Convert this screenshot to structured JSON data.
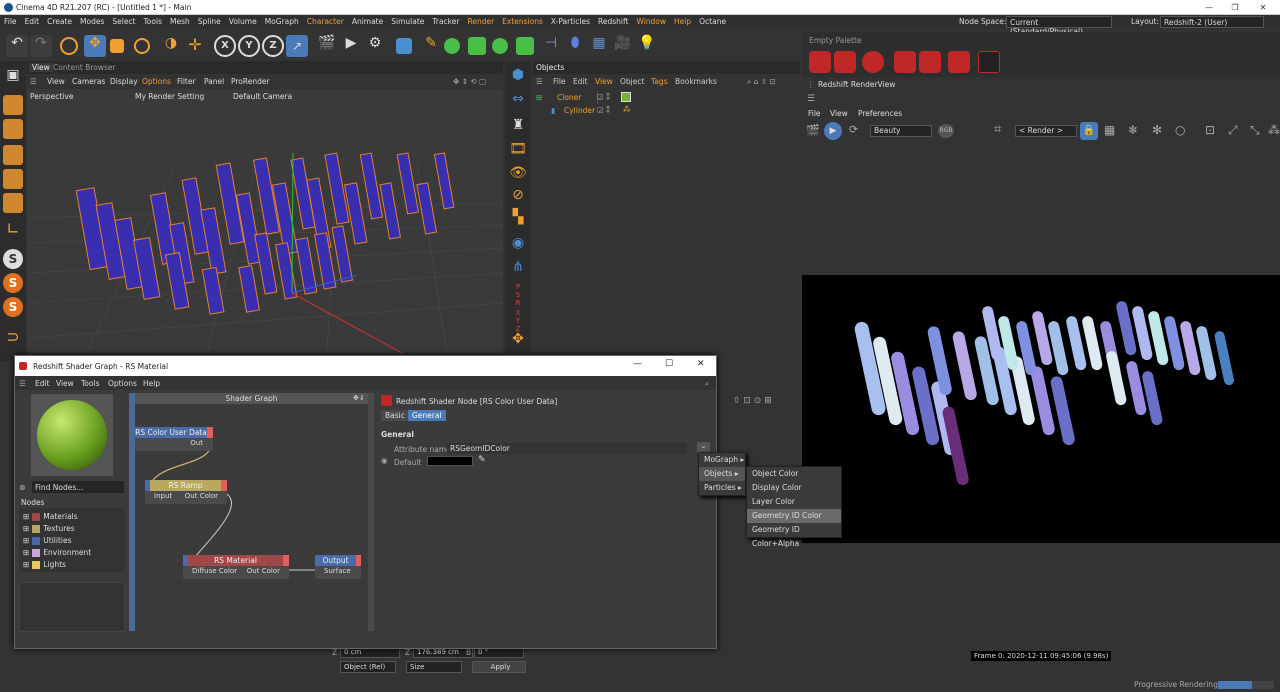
{
  "window": {
    "title": "Cinema 4D R21.207 (RC) - [Untitled 1 *] - Main"
  },
  "menubar": {
    "items": [
      "File",
      "Edit",
      "Create",
      "Modes",
      "Select",
      "Tools",
      "Mesh",
      "Spline",
      "Volume",
      "MoGraph",
      "Character",
      "Animate",
      "Simulate",
      "Tracker",
      "Render",
      "Extensions",
      "X-Particles",
      "Redshift",
      "Window",
      "Help",
      "Octane"
    ],
    "node_space_label": "Node Space:",
    "node_space_value": "Current (Standard/Physical)",
    "layout_label": "Layout:",
    "layout_value": "Redshift-2 (User)"
  },
  "viewport": {
    "tabs": [
      "View",
      "Content Browser"
    ],
    "menu": [
      "View",
      "Cameras",
      "Display",
      "Options",
      "Filter",
      "Panel",
      "ProRender"
    ],
    "camera": "Perspective",
    "render_setting": "My Render Setting",
    "default_camera": "Default Camera"
  },
  "objects": {
    "tab": "Objects",
    "menu": [
      "File",
      "Edit",
      "View",
      "Object",
      "Tags",
      "Bookmarks"
    ],
    "rows": [
      {
        "name": "Cloner"
      },
      {
        "name": "Cylinder"
      }
    ]
  },
  "palette": {
    "label": "Empty Palette"
  },
  "renderview": {
    "title": "Redshift RenderView",
    "menu": [
      "File",
      "View",
      "Preferences"
    ],
    "aov": "Beauty",
    "camera": "< Render >",
    "frame_info": "Frame  0:  2020-12-11  09:45:06  (9.98s)",
    "status": "Progressive Rendering...",
    "progress": 0.6
  },
  "shader_graph": {
    "title": "Redshift Shader Graph - RS Material",
    "menu": [
      "Edit",
      "View",
      "Tools",
      "Options",
      "Help"
    ],
    "canvas_title": "Shader Graph",
    "find_placeholder": "Find Nodes...",
    "nodes_label": "Nodes",
    "tree": [
      {
        "label": "Materials",
        "color": "#a04848"
      },
      {
        "label": "Textures",
        "color": "#b8a860"
      },
      {
        "label": "Utilities",
        "color": "#4a64a8"
      },
      {
        "label": "Environment",
        "color": "#c8a8d8"
      },
      {
        "label": "Lights",
        "color": "#e8c860"
      }
    ],
    "node_color_user_data": {
      "title": "RS Color User Data",
      "out": "Out"
    },
    "node_ramp": {
      "title": "RS Ramp",
      "in": "Input",
      "out": "Out Color"
    },
    "node_material": {
      "title": "RS Material",
      "in": "Diffuse Color",
      "out": "Out Color"
    },
    "node_output": {
      "title": "Output",
      "in": "Surface"
    },
    "attr_panel": {
      "header": "Redshift Shader Node [RS Color User Data]",
      "tabs": [
        "Basic",
        "General"
      ],
      "section": "General",
      "attribute_name_label": "Attribute name",
      "attribute_name_value": "RSGeomIDColor",
      "default_label": "Default"
    },
    "menu1": [
      "MoGraph",
      "Objects",
      "Particles"
    ],
    "menu2": [
      "Object Color",
      "Display Color",
      "Layer Color",
      "Geometry ID Color",
      "Geometry ID Color+Alpha"
    ]
  },
  "coords": {
    "z_label": "Z",
    "z_pos": "0 cm",
    "z_size": "176.389 cm",
    "b_label": "B",
    "b_rot": "0 °",
    "mode": "Object (Rel)",
    "size_mode": "Size",
    "apply": "Apply"
  },
  "colors": {
    "accent": "#f0a030",
    "selection": "#4a7ab8"
  }
}
